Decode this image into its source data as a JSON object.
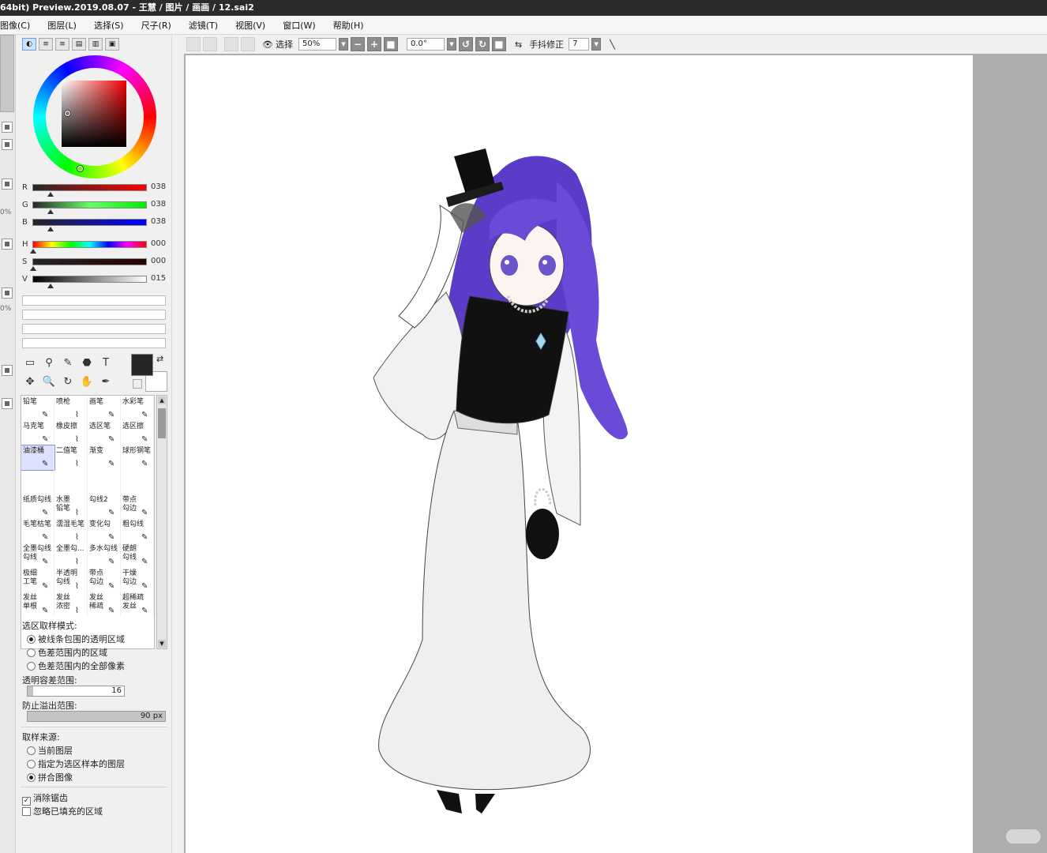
{
  "title": "64bit) Preview.2019.08.07 - 王慧 / 图片 / 画画 / 12.sai2",
  "menu": [
    "图像(C)",
    "图层(L)",
    "选择(S)",
    "尺子(R)",
    "滤镜(T)",
    "视图(V)",
    "窗口(W)",
    "帮助(H)"
  ],
  "left_strip": {
    "pct1": "0%",
    "pct2": "0%"
  },
  "color": {
    "r": {
      "label": "R",
      "value": "038"
    },
    "g": {
      "label": "G",
      "value": "038"
    },
    "b": {
      "label": "B",
      "value": "038"
    },
    "h": {
      "label": "H",
      "value": "000"
    },
    "s": {
      "label": "S",
      "value": "000"
    },
    "v": {
      "label": "V",
      "value": "015"
    },
    "foreground": "#262626",
    "background": "#ffffff"
  },
  "toolbar": {
    "select_label": "选择",
    "zoom": "50%",
    "rotation": "0.0°",
    "stabilizer_label": "手抖修正",
    "stabilizer_value": "7"
  },
  "brushes": [
    [
      "铅笔",
      "喷枪",
      "画笔",
      "水彩笔"
    ],
    [
      "马克笔",
      "橡皮擦",
      "选区笔",
      "选区擦"
    ],
    [
      "油漆桶",
      "二值笔",
      "渐变",
      "球形钢笔"
    ],
    [
      "",
      "",
      "",
      ""
    ],
    [
      "纸质勾线",
      "水墨\n铅笔",
      "勾线2",
      "带点\n勾边"
    ],
    [
      "毛笔枯笔",
      "濡湿毛笔",
      "变化勾",
      "粗勾线"
    ],
    [
      "全墨勾线\n勾线",
      "全墨勾...",
      "多水勾线",
      "硬朗\n勾线"
    ],
    [
      "极细\n工笔",
      "半透明\n勾线",
      "带点\n勾边",
      "干燥\n勾边"
    ],
    [
      "发丝\n单根",
      "发丝\n浓密",
      "发丝\n稀疏",
      "超稀疏\n发丝"
    ]
  ],
  "options": {
    "mode_label": "选区取样模式:",
    "mode_opt1": "被线条包围的透明区域",
    "mode_opt2": "色差范围内的区域",
    "mode_opt3": "色差范围内的全部像素",
    "tolerance_label": "透明容差范围:",
    "tolerance_value": "16",
    "tolerance_fraction": 0.06,
    "overflow_label": "防止溢出范围:",
    "overflow_value": "90",
    "overflow_unit": "px",
    "source_label": "取样来源:",
    "source_opt1": "当前图层",
    "source_opt2": "指定为选区样本的图层",
    "source_opt3": "拼合图像",
    "antialias": "消除锯齿",
    "ignore_filled": "忽略已填充的区域"
  },
  "tools": [
    "▭",
    "⚲",
    "✎",
    "⬣",
    "T",
    "✥",
    "🔍",
    "↻",
    "✋",
    "✒"
  ]
}
